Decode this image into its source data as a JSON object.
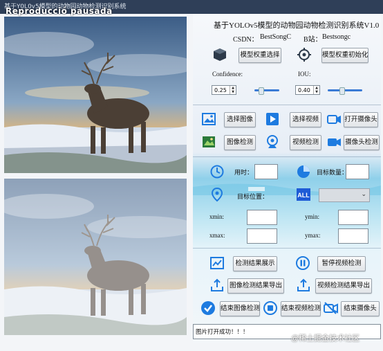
{
  "titlebar": {
    "window_title": "基于YOLOv5模型的动物园动物检测识别系统",
    "overlay_text": "Reproducció pausada"
  },
  "header": {
    "title": "基于YOLOv5模型的动物园动物检测识别系统V1.0",
    "csdn_label": "CSDN：",
    "csdn_value": "BestSongC",
    "bilibili_label": "B站：",
    "bilibili_value": "Bestsongc"
  },
  "model": {
    "select_button": "模型权重选择",
    "init_button": "模型权重初始化",
    "confidence_label": "Confidence:",
    "confidence_value": "0.25",
    "confidence_fraction": 0.25,
    "iou_label": "IOU:",
    "iou_value": "0.40",
    "iou_fraction": 0.4
  },
  "input": {
    "select_image": "选择图像",
    "select_video": "选择视频",
    "open_camera": "打开摄像头",
    "image_detect": "图像检测",
    "video_detect": "视频检测",
    "camera_detect": "摄像头检测"
  },
  "results": {
    "time_label": "用时：",
    "target_count_label": "目标数量：",
    "target_position_label": "目标位置：",
    "xmin_label": "xmin:",
    "ymin_label": "ymin:",
    "xmax_label": "xmax:",
    "ymax_label": "ymax:",
    "time_value": "",
    "target_count_value": "",
    "xmin_value": "",
    "ymin_value": "",
    "xmax_value": "",
    "ymax_value": ""
  },
  "actions": {
    "show_result": "检测结果展示",
    "pause_video": "暂停视频检测",
    "export_image": "图像检测结果导出",
    "export_video": "视频检测结果导出",
    "end_image": "结束图像检测",
    "end_video": "结束视频检测",
    "end_camera": "结束摄像头"
  },
  "status": {
    "text": "图片打开成功！！！"
  },
  "watermark": {
    "text": "@稀土掘金技术社区"
  },
  "colors": {
    "titlebar": "#2f3f58",
    "accent_blue": "#1e7be0",
    "slider": "#3a7bd5"
  }
}
